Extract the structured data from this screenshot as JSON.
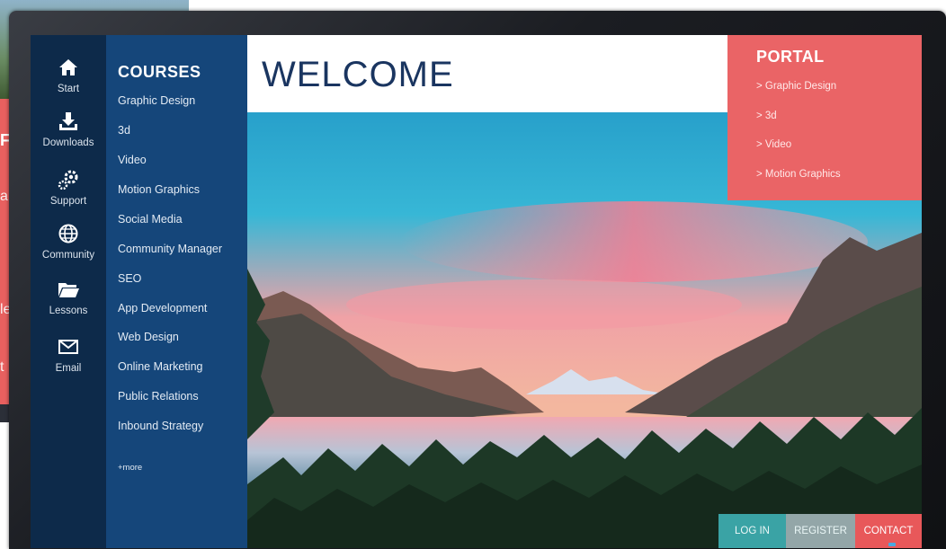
{
  "background_page": {
    "letter": "F",
    "fragments": [
      "a",
      "le",
      "t"
    ]
  },
  "rail": {
    "items": [
      {
        "label": "Start",
        "icon": "home-icon"
      },
      {
        "label": "Downloads",
        "icon": "download-icon"
      },
      {
        "label": "Support",
        "icon": "gears-icon"
      },
      {
        "label": "Community",
        "icon": "globe-icon"
      },
      {
        "label": "Lessons",
        "icon": "folder-icon"
      },
      {
        "label": "Email",
        "icon": "envelope-icon"
      }
    ]
  },
  "courses": {
    "title": "COURSES",
    "items": [
      "Graphic Design",
      "3d",
      "Video",
      "Motion Graphics",
      "Social Media",
      "Community Manager",
      "SEO",
      "App Development",
      "Web Design",
      "Online Marketing",
      "Public Relations",
      "Inbound Strategy"
    ],
    "more": "+more"
  },
  "hero": {
    "title": "WELCOME"
  },
  "portal": {
    "title": "PORTAL",
    "links": [
      "> Graphic Design",
      "> 3d",
      "> Video",
      "> Motion Graphics"
    ]
  },
  "actions": {
    "login": "LOG IN",
    "register": "REGISTER",
    "contact": "CONTACT"
  },
  "colors": {
    "rail": "#0d2a4a",
    "courses": "#15467a",
    "portal": "#ea6466",
    "login": "#3aa3a5",
    "register": "#93a6a8",
    "contact": "#e8585a"
  }
}
